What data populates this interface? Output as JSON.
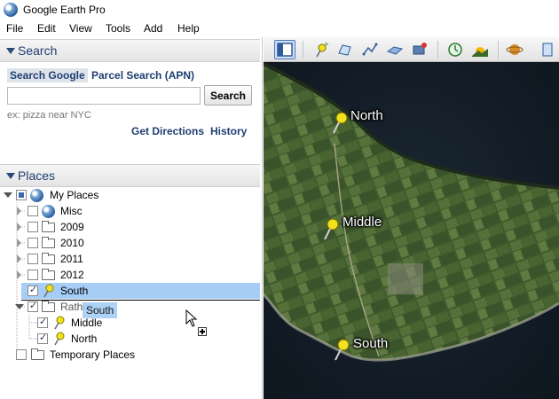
{
  "window": {
    "title": "Google Earth Pro"
  },
  "menu": [
    "File",
    "Edit",
    "View",
    "Tools",
    "Add",
    "Help"
  ],
  "search_panel": {
    "header": "Search",
    "tab_active": "Search Google",
    "tab_other": "Parcel Search (APN)",
    "input_value": "",
    "button": "Search",
    "hint": "ex: pizza near NYC",
    "link_directions": "Get Directions",
    "link_history": "History"
  },
  "places_panel": {
    "header": "Places",
    "items": [
      {
        "label": "My Places",
        "icon": "globe-icon",
        "check": "partial",
        "expander": "open"
      },
      {
        "label": "Misc",
        "icon": "globe-icon",
        "check": "unchecked",
        "expander": "closed"
      },
      {
        "label": "2009",
        "icon": "folder-icon",
        "check": "unchecked",
        "expander": "closed"
      },
      {
        "label": "2010",
        "icon": "folder-icon",
        "check": "unchecked",
        "expander": "closed"
      },
      {
        "label": "2011",
        "icon": "folder-icon",
        "check": "unchecked",
        "expander": "closed"
      },
      {
        "label": "2012",
        "icon": "folder-icon",
        "check": "unchecked",
        "expander": "closed"
      },
      {
        "label": "South",
        "icon": "pushpin-icon",
        "check": "checked",
        "selected": true
      },
      {
        "label": "Rathlin",
        "icon": "folder-open-icon",
        "check": "checked",
        "expander": "open"
      },
      {
        "label": "Middle",
        "icon": "pushpin-icon",
        "check": "checked"
      },
      {
        "label": "North",
        "icon": "pushpin-icon",
        "check": "checked"
      },
      {
        "label": "Temporary Places",
        "icon": "folder-icon",
        "check": "unchecked"
      }
    ],
    "drag_ghost_label": "South"
  },
  "map": {
    "placemarks": [
      {
        "label": "North",
        "icon": "yellow-pushpin-icon"
      },
      {
        "label": "Middle",
        "icon": "yellow-pushpin-icon"
      },
      {
        "label": "South",
        "icon": "yellow-pushpin-icon"
      }
    ]
  },
  "toolbar": {
    "buttons": [
      "sidebar-toggle-icon",
      "add-placemark-icon",
      "add-polygon-icon",
      "add-path-icon",
      "add-image-overlay-icon",
      "record-tour-icon",
      "historical-imagery-icon",
      "sunlight-icon",
      "planets-icon"
    ]
  },
  "colors": {
    "header_text": "#1f3e72",
    "selection": "#a6cdf6",
    "pin_yellow": "#f2e11d"
  }
}
